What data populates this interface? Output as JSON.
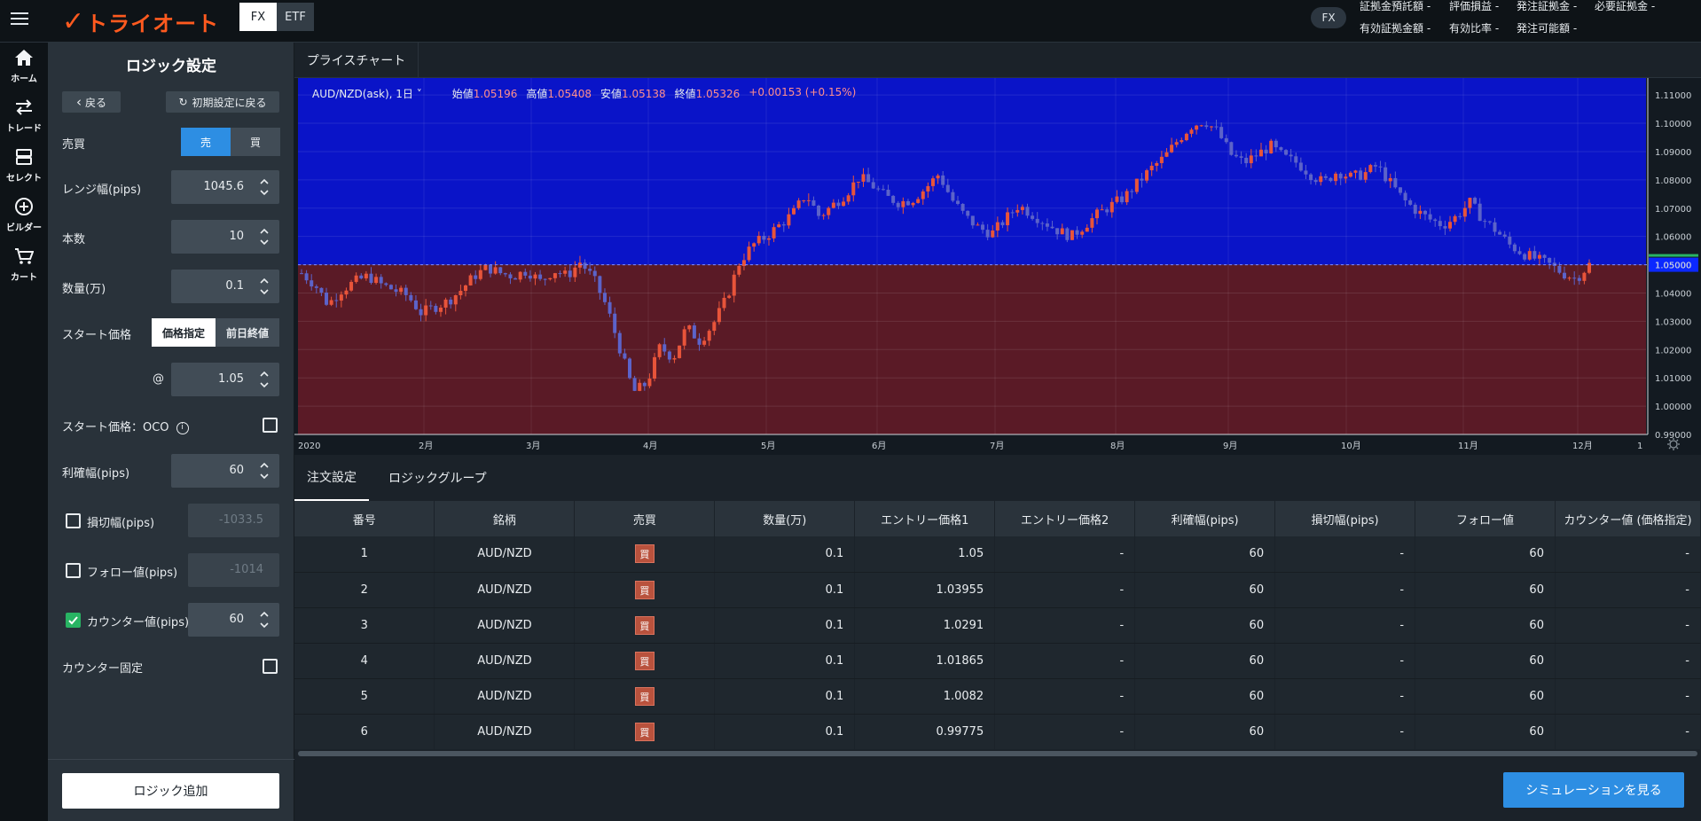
{
  "header": {
    "logo_text": "トライオート",
    "market_tabs": [
      {
        "label": "FX",
        "active": true
      },
      {
        "label": "ETF",
        "active": false
      }
    ],
    "product_badge": "FX",
    "summary": [
      {
        "label": "証拠金預託額",
        "value": "-"
      },
      {
        "label": "評価損益",
        "value": "-"
      },
      {
        "label": "発注証拠金",
        "value": "-"
      },
      {
        "label": "必要証拠金",
        "value": "-"
      },
      {
        "label": "有効証拠金額",
        "value": "-"
      },
      {
        "label": "有効比率",
        "value": "-"
      },
      {
        "label": "発注可能額",
        "value": "-"
      }
    ]
  },
  "nav": [
    {
      "label": "ホーム",
      "icon": "home-icon"
    },
    {
      "label": "トレード",
      "icon": "trade-arrows-icon"
    },
    {
      "label": "セレクト",
      "icon": "select-icon"
    },
    {
      "label": "ビルダー",
      "icon": "builder-plus-icon"
    },
    {
      "label": "カート",
      "icon": "cart-icon"
    }
  ],
  "logic": {
    "title": "ロジック設定",
    "back_label": "戻る",
    "reset_label": "初期設定に戻る",
    "side_label": "売買",
    "side_options": [
      "売",
      "買"
    ],
    "side_selected": "売",
    "range_label": "レンジ幅(pips)",
    "range_value": "1045.6",
    "count_label": "本数",
    "count_value": "10",
    "qty_label": "数量(万)",
    "qty_value": "0.1",
    "start_label": "スタート価格",
    "start_options": [
      "価格指定",
      "前日終値"
    ],
    "start_selected": "価格指定",
    "at_label": "@",
    "start_price": "1.05",
    "oco_label": "スタート価格：OCO",
    "oco_checked": false,
    "take_profit_label": "利確幅(pips)",
    "take_profit_value": "60",
    "stop_loss_label": "損切幅(pips)",
    "stop_loss_value": "-1033.5",
    "stop_loss_checked": false,
    "follow_label": "フォロー値(pips)",
    "follow_value": "-1014",
    "follow_checked": false,
    "counter_label": "カウンター値(pips)",
    "counter_value": "60",
    "counter_checked": true,
    "counter_fixed_label": "カウンター固定",
    "counter_fixed_checked": false,
    "add_label": "ロジック追加"
  },
  "chart": {
    "tab_label": "プライスチャート",
    "symbol": "AUD/NZD(ask), 1日",
    "ohlc": [
      {
        "label": "始値",
        "value": "1.05196"
      },
      {
        "label": "高値",
        "value": "1.05408"
      },
      {
        "label": "安値",
        "value": "1.05138"
      },
      {
        "label": "終値",
        "value": "1.05326"
      }
    ],
    "change": "+0.00153 (+0.15%)",
    "colors": {
      "sell_zone": "#0a14c8",
      "buy_zone": "#5a1a26",
      "up": "#e8543a",
      "down": "#5c63c9",
      "price_tag": "#0b28ff"
    }
  },
  "chart_data": {
    "type": "candlestick",
    "title": "",
    "xlabel": "",
    "ylabel": "",
    "x_ticks": [
      "2020",
      "2月",
      "3月",
      "4月",
      "5月",
      "6月",
      "7月",
      "8月",
      "9月",
      "10月",
      "11月",
      "12月",
      "1"
    ],
    "y_ticks": [
      "1.11000",
      "1.10000",
      "1.09000",
      "1.08000",
      "1.07000",
      "1.06000",
      "1.05000",
      "1.04000",
      "1.03000",
      "1.02000",
      "1.01000",
      "1.00000",
      "0.99000"
    ],
    "ylim": [
      0.99,
      1.116
    ],
    "current_price": "1.05000",
    "closes": [
      1.047,
      1.043,
      1.036,
      1.041,
      1.044,
      1.046,
      1.043,
      1.041,
      1.039,
      1.033,
      1.035,
      1.037,
      1.041,
      1.046,
      1.049,
      1.047,
      1.046,
      1.048,
      1.044,
      1.048,
      1.046,
      1.051,
      1.045,
      1.035,
      1.02,
      1.005,
      1.008,
      1.021,
      1.017,
      1.028,
      1.023,
      1.029,
      1.038,
      1.051,
      1.057,
      1.06,
      1.064,
      1.068,
      1.075,
      1.067,
      1.071,
      1.075,
      1.081,
      1.078,
      1.074,
      1.072,
      1.073,
      1.077,
      1.082,
      1.073,
      1.067,
      1.063,
      1.061,
      1.066,
      1.071,
      1.068,
      1.065,
      1.062,
      1.06,
      1.064,
      1.068,
      1.071,
      1.074,
      1.079,
      1.084,
      1.088,
      1.094,
      1.099,
      1.101,
      1.097,
      1.089,
      1.086,
      1.089,
      1.092,
      1.088,
      1.086,
      1.082,
      1.079,
      1.083,
      1.081,
      1.082,
      1.085,
      1.079,
      1.073,
      1.069,
      1.066,
      1.064,
      1.067,
      1.072,
      1.066,
      1.062,
      1.057,
      1.054,
      1.052,
      1.05,
      1.047,
      1.045,
      1.05
    ]
  },
  "bottom_tabs": [
    "注文設定",
    "ロジックグループ"
  ],
  "table": {
    "columns": [
      "番号",
      "銘柄",
      "売買",
      "数量(万)",
      "エントリー価格1",
      "エントリー価格2",
      "利確幅(pips)",
      "損切幅(pips)",
      "フォロー値",
      "カウンター値 (価格指定)"
    ],
    "rows": [
      {
        "no": "1",
        "symbol": "AUD/NZD",
        "side": "買",
        "qty": "0.1",
        "entry1": "1.05",
        "entry2": "-",
        "tp": "60",
        "sl": "-",
        "follow": "60",
        "counter": "-"
      },
      {
        "no": "2",
        "symbol": "AUD/NZD",
        "side": "買",
        "qty": "0.1",
        "entry1": "1.03955",
        "entry2": "-",
        "tp": "60",
        "sl": "-",
        "follow": "60",
        "counter": "-"
      },
      {
        "no": "3",
        "symbol": "AUD/NZD",
        "side": "買",
        "qty": "0.1",
        "entry1": "1.0291",
        "entry2": "-",
        "tp": "60",
        "sl": "-",
        "follow": "60",
        "counter": "-"
      },
      {
        "no": "4",
        "symbol": "AUD/NZD",
        "side": "買",
        "qty": "0.1",
        "entry1": "1.01865",
        "entry2": "-",
        "tp": "60",
        "sl": "-",
        "follow": "60",
        "counter": "-"
      },
      {
        "no": "5",
        "symbol": "AUD/NZD",
        "side": "買",
        "qty": "0.1",
        "entry1": "1.0082",
        "entry2": "-",
        "tp": "60",
        "sl": "-",
        "follow": "60",
        "counter": "-"
      },
      {
        "no": "6",
        "symbol": "AUD/NZD",
        "side": "買",
        "qty": "0.1",
        "entry1": "0.99775",
        "entry2": "-",
        "tp": "60",
        "sl": "-",
        "follow": "60",
        "counter": "-"
      }
    ]
  },
  "simulate_label": "シミュレーションを見る"
}
